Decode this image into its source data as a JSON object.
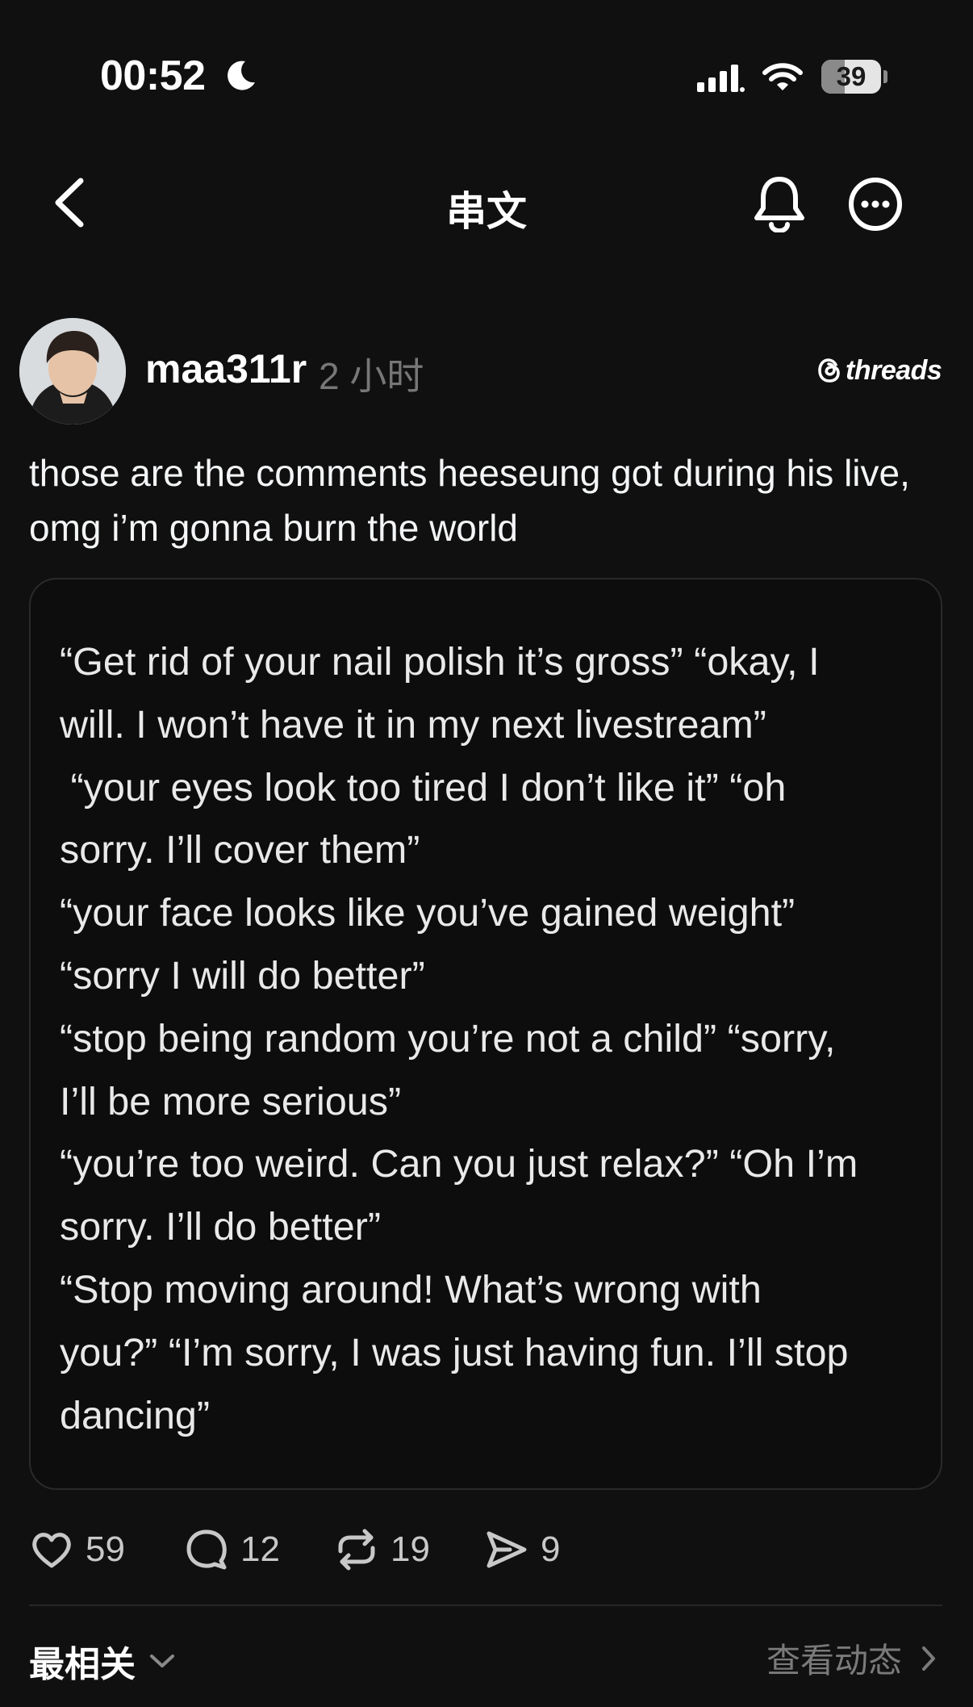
{
  "status_bar": {
    "time": "00:52",
    "battery_level": "39",
    "battery_fraction": 0.39,
    "icons": [
      "moon-icon",
      "cellular-signal-icon",
      "wifi-icon",
      "battery-icon"
    ]
  },
  "nav": {
    "title": "串文",
    "icons": [
      "back-chevron-icon",
      "bell-icon",
      "more-dots-icon"
    ]
  },
  "post": {
    "username": "maa311r",
    "time_ago": "2 小时",
    "brand": "threads",
    "text": "those are the comments heeseung got during his live, omg i’m gonna burn the world",
    "image_text": "“Get rid of your nail polish it’s gross” “okay, I\nwill. I won’t have it in my next livestream”\n “your eyes look too tired I don’t like it” “oh\nsorry. I’ll cover them”\n“your face looks like you’ve gained weight”\n“sorry I will do better”\n“stop being random you’re not a child” “sorry,\nI’ll be more serious”\n“you’re too weird. Can you just relax?” “Oh I’m\nsorry. I’ll do better”\n“Stop moving around! What’s wrong with\nyou?” “I’m sorry, I was just having fun. I’ll stop\ndancing”"
  },
  "actions": {
    "likes": "59",
    "comments": "12",
    "reposts": "19",
    "shares": "9"
  },
  "footer": {
    "sort_label": "最相关",
    "activity_label": "查看动态"
  },
  "colors": {
    "background": "#101010",
    "text": "#f3f5f7",
    "muted": "#777777"
  }
}
